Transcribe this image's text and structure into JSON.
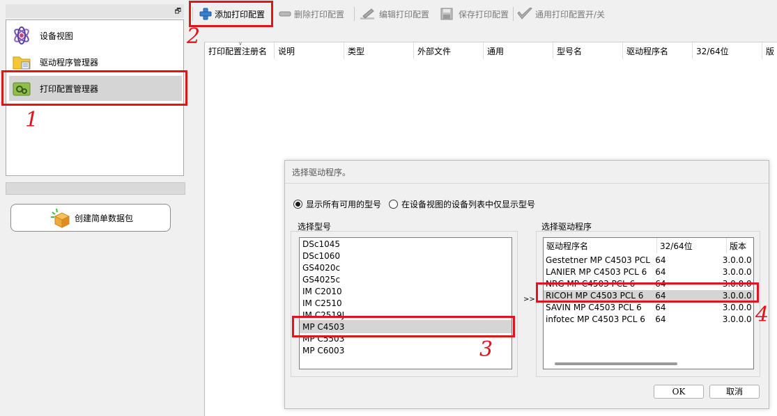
{
  "colors": {
    "annotation_red": "#e0141b",
    "selection_gray": "#d5d5d5",
    "panel_bg": "#f0f0f0"
  },
  "left_nav": {
    "items": [
      {
        "label": "设备视图",
        "icon": "atom-icon"
      },
      {
        "label": "驱动程序管理器",
        "icon": "folder-icon"
      },
      {
        "label": "打印配置管理器",
        "icon": "print-config-icon",
        "selected": true
      }
    ],
    "create_package_label": "创建简单数据包",
    "create_package_icon": "package-box-icon"
  },
  "toolbar": {
    "add_label": "添加打印配置",
    "delete_label": "删除打印配置",
    "edit_label": "编辑打印配置",
    "save_label": "保存打印配置",
    "toggle_label": "通用打印配置开/关"
  },
  "list": {
    "columns": [
      "打印配置注册名",
      "说明",
      "类型",
      "外部文件",
      "通用",
      "型号名",
      "驱动程序名",
      "32/64位",
      "版"
    ]
  },
  "dialog": {
    "title": "选择驱动程序。",
    "radio_all_label": "显示所有可用的型号",
    "radio_device_label": "在设备视图的设备列表中仅显示型号",
    "models_group_label": "选择型号",
    "models": [
      "DSc1045",
      "DSc1060",
      "GS4020c",
      "GS4025c",
      "IM C2010",
      "IM C2510",
      "IM C2519J",
      "MP C4503",
      "MP C5503",
      "MP C6003"
    ],
    "selected_model": "MP C4503",
    "transfer_symbol": ">>",
    "drivers_group_label": "选择驱动程序",
    "driver_columns": [
      "驱动程序名",
      "32/64位",
      "版本"
    ],
    "drivers": [
      {
        "name": "Gestetner MP C4503 PCL 6",
        "bits": "64",
        "version": "3.0.0.0"
      },
      {
        "name": "LANIER MP C4503 PCL 6",
        "bits": "64",
        "version": "3.0.0.0"
      },
      {
        "name": "NRG MP C4503 PCL 6",
        "bits": "64",
        "version": "3.0.0.0"
      },
      {
        "name": "RICOH MP C4503 PCL 6",
        "bits": "64",
        "version": "3.0.0.0",
        "selected": true
      },
      {
        "name": "SAVIN MP C4503 PCL 6",
        "bits": "64",
        "version": "3.0.0.0"
      },
      {
        "name": "infotec MP C4503 PCL 6",
        "bits": "64",
        "version": "3.0.0.0"
      }
    ],
    "ok_label": "OK",
    "cancel_label": "取消"
  },
  "annotations": {
    "step1": "1",
    "step2": "2",
    "step3": "3",
    "step4": "4"
  }
}
